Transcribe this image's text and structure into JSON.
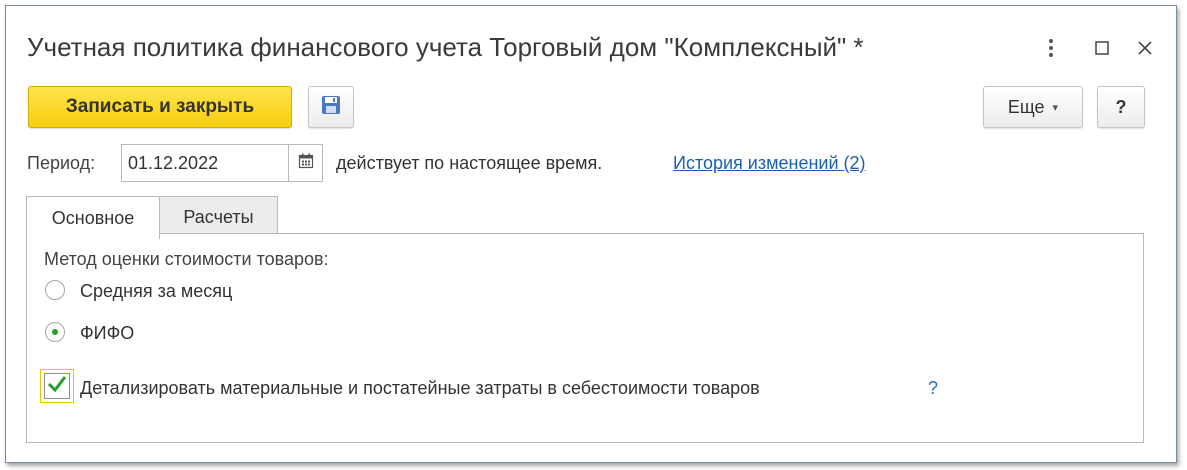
{
  "window": {
    "title": "Учетная политика финансового учета Торговый дом \"Комплексный\" *",
    "menu_icon": "vertical-dots-icon",
    "maximize_icon": "maximize-icon",
    "close_icon": "close-icon"
  },
  "toolbar": {
    "save_close_label": "Записать и закрыть",
    "save_icon": "floppy-disk-icon",
    "more_label": "Еще",
    "help_label": "?"
  },
  "period": {
    "label": "Период:",
    "value": "01.12.2022",
    "calendar_icon": "calendar-icon",
    "status_text": "действует по настоящее время.",
    "history_link": "История изменений (2)"
  },
  "tabs": [
    {
      "label": "Основное",
      "active": true
    },
    {
      "label": "Расчеты",
      "active": false
    }
  ],
  "main": {
    "method_label": "Метод оценки стоимости товаров:",
    "options": [
      {
        "label": "Средняя за месяц",
        "checked": false
      },
      {
        "label": "ФИФО",
        "checked": true
      }
    ],
    "detail_checkbox": {
      "label": "Детализировать материальные и постатейные затраты в себестоимости товаров",
      "checked": true,
      "help": "?"
    }
  },
  "colors": {
    "primary_button": "#f6cf11",
    "link": "#1a5fb4",
    "checkmark": "#2a9d2a",
    "focus_border": "#f3c400"
  }
}
